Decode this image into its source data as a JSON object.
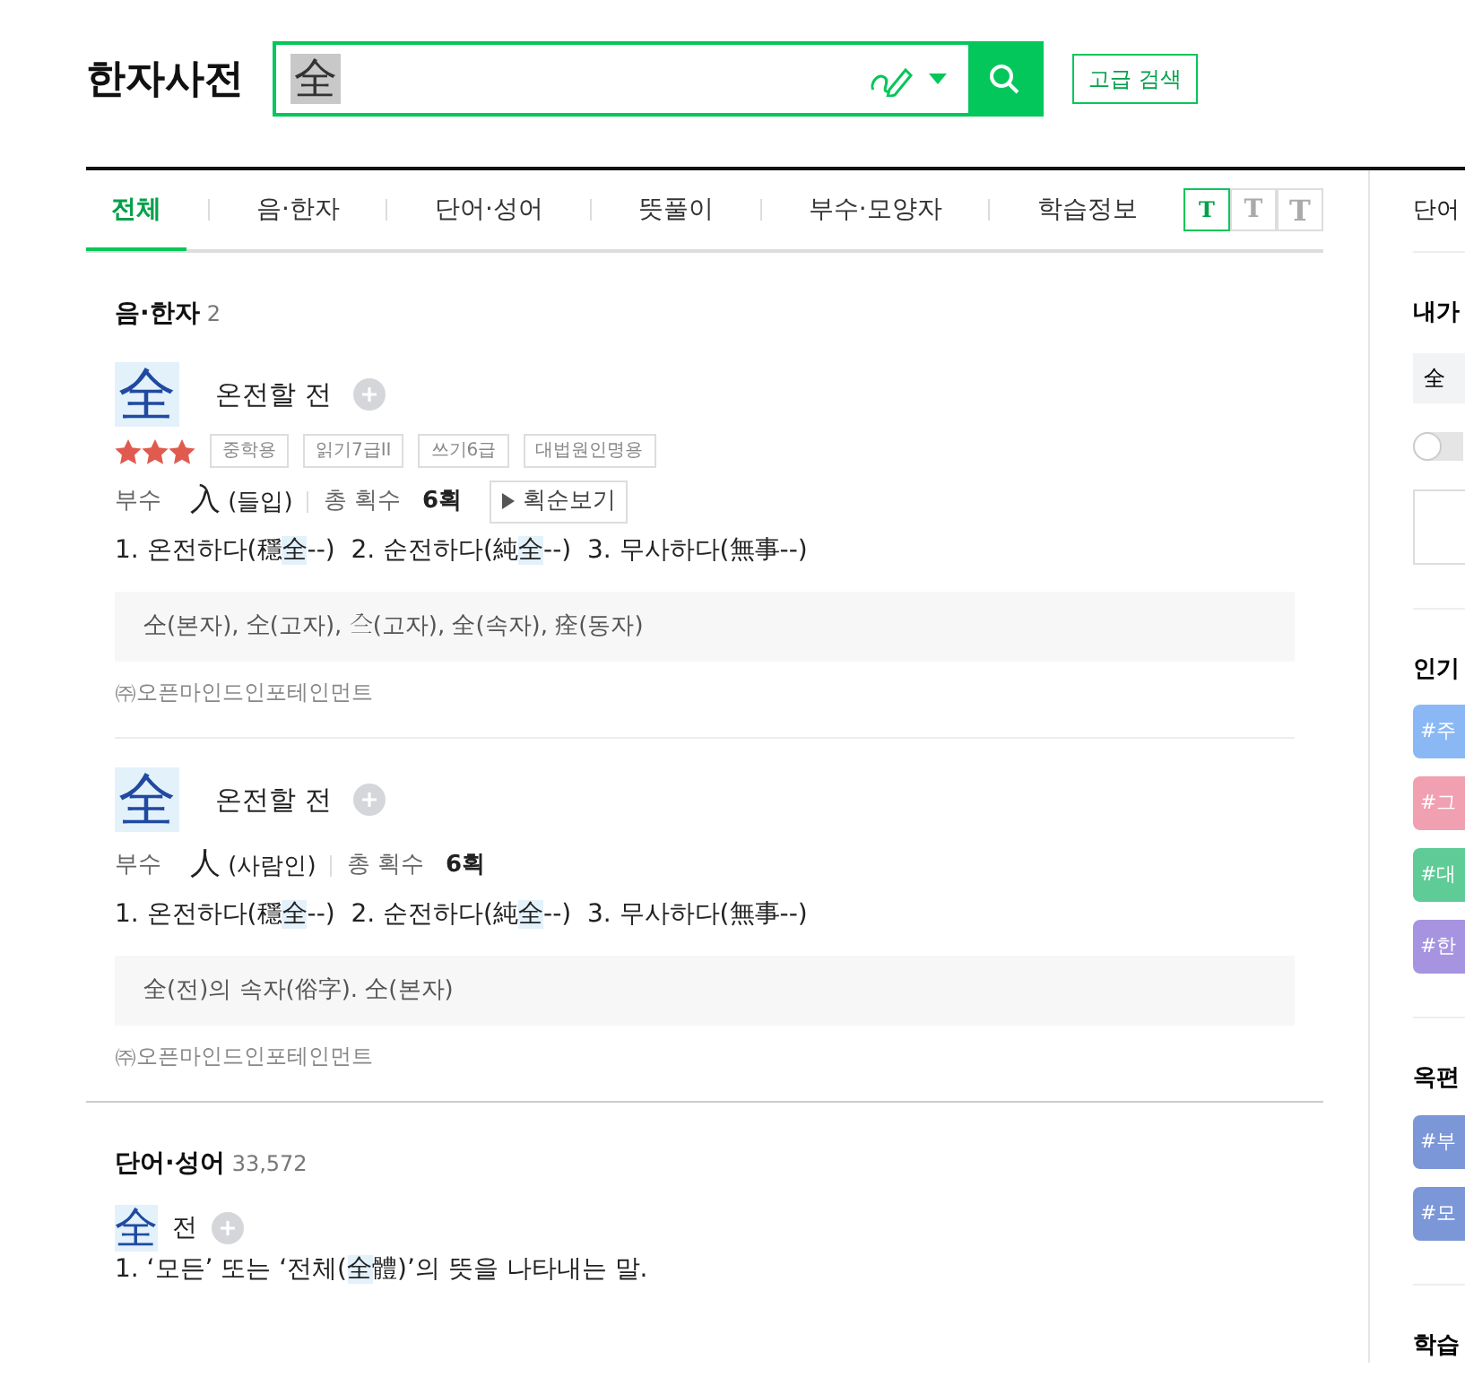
{
  "header": {
    "title": "한자사전",
    "search": {
      "value": "全"
    },
    "advanced_button": "고급 검색"
  },
  "tabs": [
    {
      "label": "전체",
      "selected": true
    },
    {
      "label": "음·한자",
      "selected": false
    },
    {
      "label": "단어·성어",
      "selected": false
    },
    {
      "label": "뜻풀이",
      "selected": false
    },
    {
      "label": "부수·모양자",
      "selected": false
    },
    {
      "label": "학습정보",
      "selected": false
    }
  ],
  "font_sizes": [
    {
      "label": "T",
      "selected": true
    },
    {
      "label": "T",
      "selected": false
    },
    {
      "label": "T",
      "selected": false
    }
  ],
  "hanja_section": {
    "title": "음·한자",
    "count": "2",
    "entries": [
      {
        "char": "全",
        "reading": "온전할 전",
        "stars": 3,
        "tags": [
          "중학용",
          "읽기7급II",
          "쓰기6급",
          "대법원인명용"
        ],
        "radical_label": "부수",
        "radical": "入",
        "radical_name": "(들입)",
        "strokes_label": "총 획수",
        "strokes": "6획",
        "stroke_button": "획순보기",
        "meanings": [
          [
            {
              "text": "1. 온전하다(穩",
              "highlight": false
            },
            {
              "text": "全",
              "highlight": true
            },
            {
              "text": "--)  2. 순전하다(純",
              "highlight": false
            },
            {
              "text": "全",
              "highlight": true
            },
            {
              "text": "--)  3. 무사하다(無事--)",
              "highlight": false
            }
          ]
        ],
        "variants": "仝(본자), 㒰(고자), 𠓞(고자), 全(속자), 痊(동자)",
        "source": "㈜오픈마인드인포테인먼트"
      },
      {
        "char": "全",
        "reading": "온전할 전",
        "radical_label": "부수",
        "radical": "人",
        "radical_name": "(사람인)",
        "strokes_label": "총 획수",
        "strokes": "6획",
        "meanings": [
          [
            {
              "text": "1. 온전하다(穩",
              "highlight": false
            },
            {
              "text": "全",
              "highlight": true
            },
            {
              "text": "--)  2. 순전하다(純",
              "highlight": false
            },
            {
              "text": "全",
              "highlight": true
            },
            {
              "text": "--)  3. 무사하다(無事--)",
              "highlight": false
            }
          ]
        ],
        "variants": "全(전)의 속자(俗字). 仝(본자)",
        "source": "㈜오픈마인드인포테인먼트"
      }
    ]
  },
  "word_section": {
    "title": "단어·성어",
    "count": "33,572",
    "entries": [
      {
        "char": "全",
        "reading": "전",
        "meaning": [
          {
            "text": "1. ‘모든’ 또는 ‘전체(",
            "highlight": false
          },
          {
            "text": "全",
            "highlight": true
          },
          {
            "text": "體)’의 뜻을 나타내는 말.",
            "highlight": false
          }
        ]
      }
    ]
  },
  "sidebar": {
    "top_link": "단어",
    "my_title": "내가",
    "my_chip": "全",
    "toggle": {
      "on": false
    },
    "popular_title": "인기",
    "popular_tags": [
      {
        "label": "#주",
        "color": "#8ab8f5"
      },
      {
        "label": "#그",
        "color": "#f0a0b0"
      },
      {
        "label": "#대",
        "color": "#5fcb96"
      },
      {
        "label": "#한",
        "color": "#a694e0"
      }
    ],
    "radical_title": "옥편",
    "radical_tags": [
      {
        "label": "#부",
        "color": "#7b97d8"
      },
      {
        "label": "#모",
        "color": "#7b97d8"
      }
    ],
    "study_title": "학습"
  }
}
